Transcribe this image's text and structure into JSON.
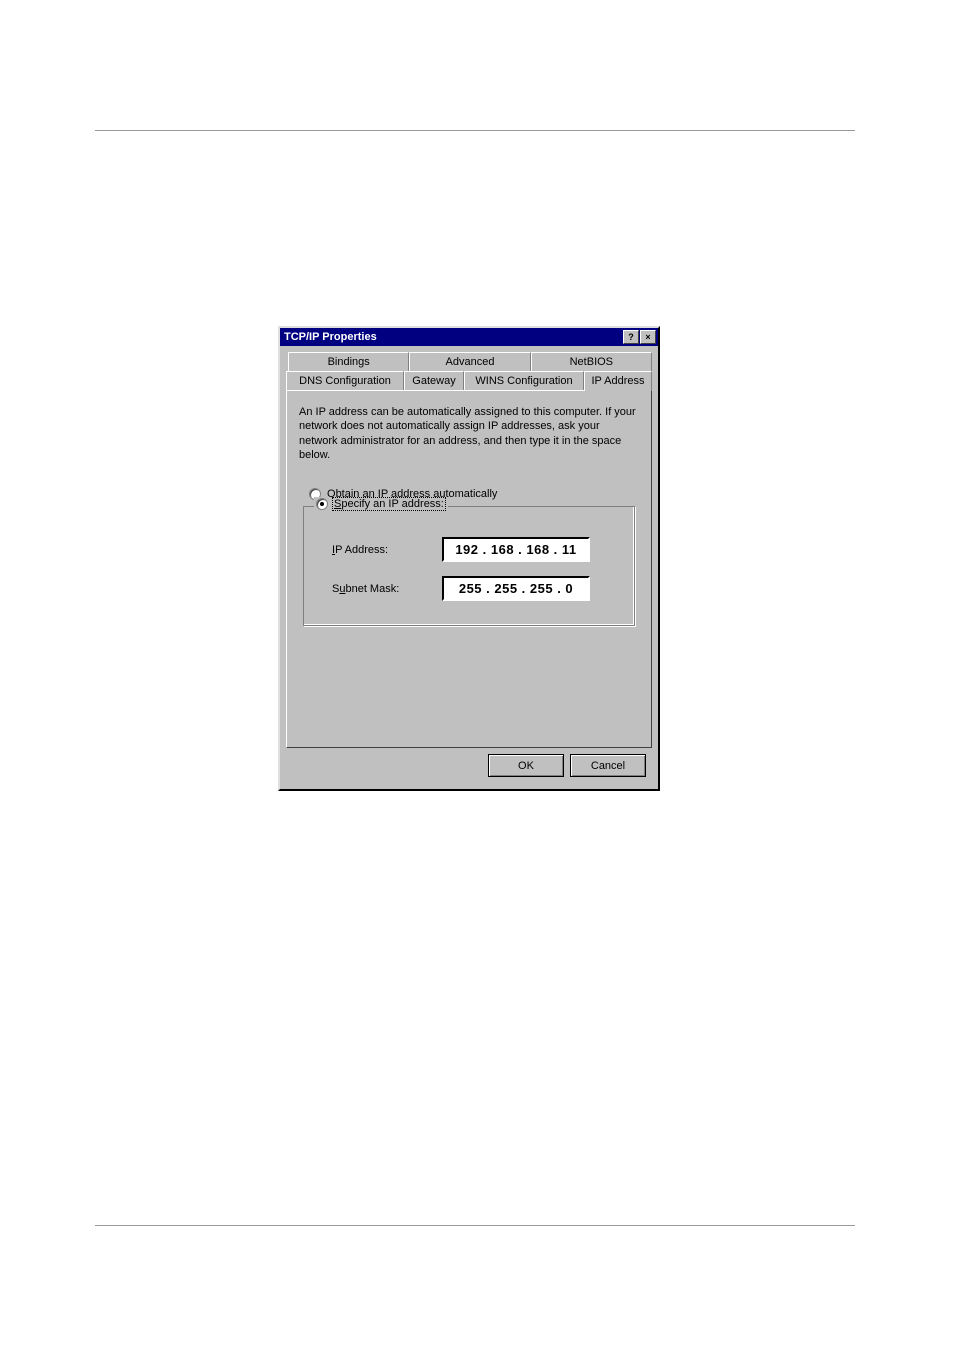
{
  "dialog": {
    "title": "TCP/IP Properties",
    "help_icon": "?",
    "close_icon": "×"
  },
  "tabs": {
    "back_row": [
      {
        "label": "Bindings"
      },
      {
        "label": "Advanced"
      },
      {
        "label": "NetBIOS"
      }
    ],
    "front_row": [
      {
        "label": "DNS Configuration"
      },
      {
        "label": "Gateway"
      },
      {
        "label": "WINS Configuration"
      },
      {
        "label": "IP Address",
        "active": true
      }
    ]
  },
  "panel": {
    "description": "An IP address can be automatically assigned to this computer. If your network does not automatically assign IP addresses, ask your network administrator for an address, and then type it in the space below.",
    "radio_obtain": "Obtain an IP address automatically",
    "radio_obtain_prefix": "O",
    "radio_obtain_rest": "btain an IP address automatically",
    "radio_specify_prefix": "S",
    "radio_specify_rest": "pecify an IP address:",
    "ip_label_prefix": "I",
    "ip_label_rest": "P Address:",
    "subnet_label_pre": "S",
    "subnet_label_u": "u",
    "subnet_label_rest": "bnet Mask:",
    "ip_value": "192 . 168 . 168 . 11",
    "subnet_value": "255 . 255 . 255 .  0"
  },
  "buttons": {
    "ok": "OK",
    "cancel": "Cancel"
  }
}
